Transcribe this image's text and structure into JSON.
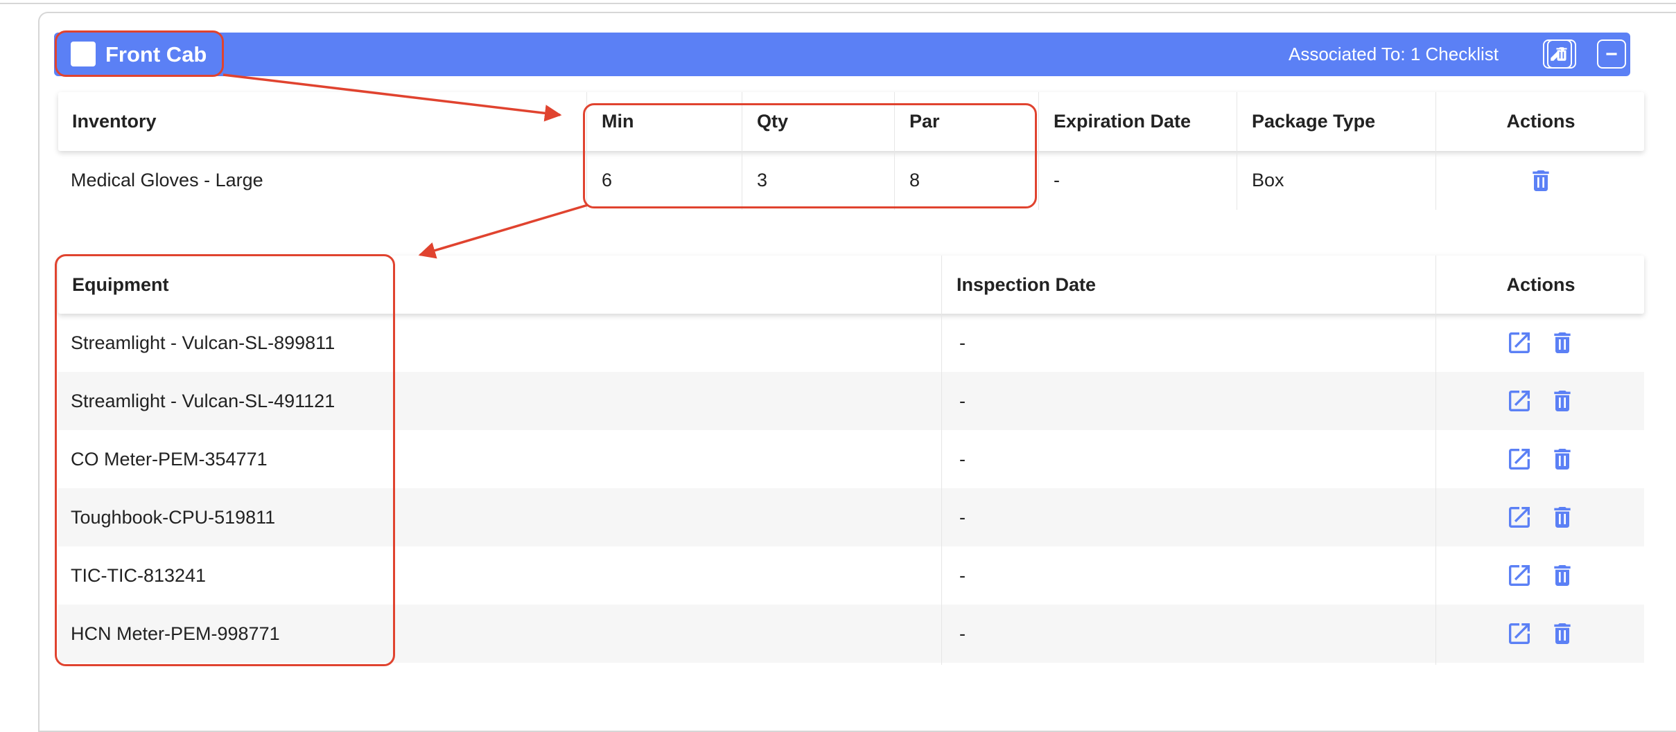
{
  "section": {
    "title": "Front Cab",
    "associated": "Associated To: 1 Checklist",
    "accent": "#5b80f5"
  },
  "inventory": {
    "headers": {
      "name": "Inventory",
      "min": "Min",
      "qty": "Qty",
      "par": "Par",
      "expiration": "Expiration Date",
      "package": "Package Type",
      "actions": "Actions"
    },
    "rows": [
      {
        "name": "Medical Gloves - Large",
        "min": "6",
        "qty": "3",
        "par": "8",
        "expiration": "-",
        "package": "Box"
      }
    ]
  },
  "equipment": {
    "headers": {
      "name": "Equipment",
      "inspection": "Inspection Date",
      "actions": "Actions"
    },
    "rows": [
      {
        "name": "Streamlight - Vulcan-SL-899811",
        "inspection": "-"
      },
      {
        "name": "Streamlight - Vulcan-SL-491121",
        "inspection": "-"
      },
      {
        "name": "CO Meter-PEM-354771",
        "inspection": "-"
      },
      {
        "name": "Toughbook-CPU-519811",
        "inspection": "-"
      },
      {
        "name": "TIC-TIC-813241",
        "inspection": "-"
      },
      {
        "name": "HCN Meter-PEM-998771",
        "inspection": "-"
      }
    ]
  },
  "annotation_color": "#e0432f",
  "icons": {
    "edit": "pencil-icon",
    "delete": "trash-icon",
    "collapse": "minus-icon",
    "open": "external-link-icon"
  }
}
